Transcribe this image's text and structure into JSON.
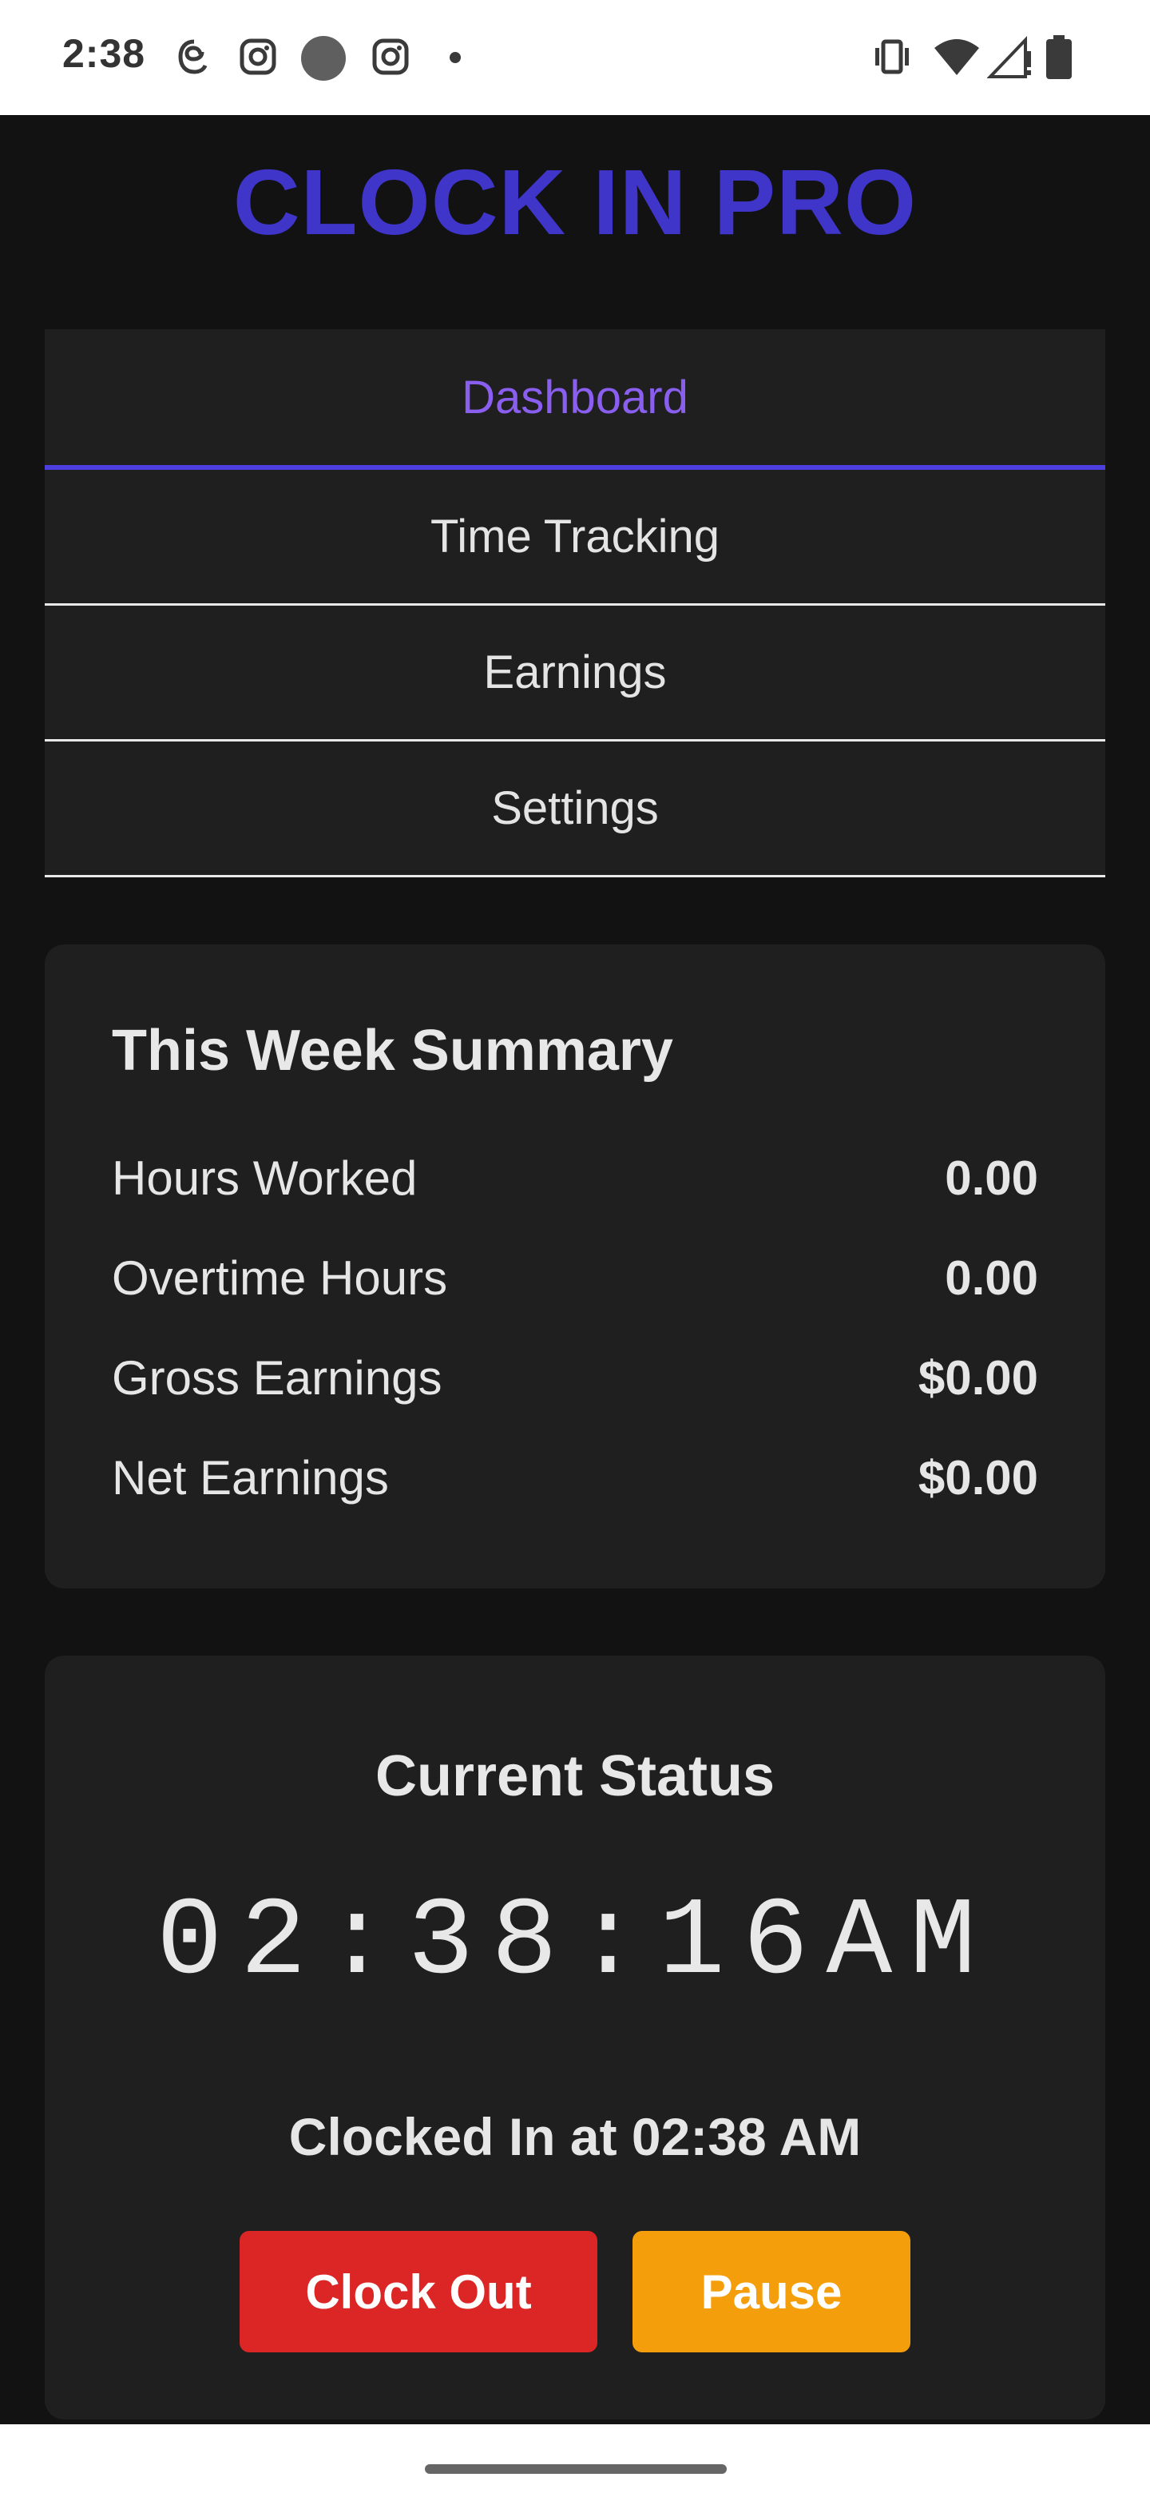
{
  "status_bar": {
    "time": "2:38",
    "left_icons": [
      "threads-icon",
      "instagram-icon",
      "circle-icon",
      "instagram-icon",
      "dot-icon"
    ],
    "right_icons": [
      "vibrate-icon",
      "wifi-icon",
      "signal-icon",
      "battery-icon"
    ]
  },
  "app": {
    "title": "CLOCK IN PRO",
    "accent_color": "#3f35c9"
  },
  "nav": {
    "items": [
      {
        "label": "Dashboard",
        "active": true
      },
      {
        "label": "Time Tracking",
        "active": false
      },
      {
        "label": "Earnings",
        "active": false
      },
      {
        "label": "Settings",
        "active": false
      }
    ]
  },
  "summary": {
    "title": "This Week Summary",
    "rows": [
      {
        "label": "Hours Worked",
        "value": "0.00"
      },
      {
        "label": "Overtime Hours",
        "value": "0.00"
      },
      {
        "label": "Gross Earnings",
        "value": "$0.00"
      },
      {
        "label": "Net Earnings",
        "value": "$0.00"
      }
    ]
  },
  "status": {
    "title": "Current Status",
    "clock": "02:38:16AM",
    "clocked_in_text": "Clocked In at 02:38 AM",
    "clock_out_label": "Clock Out",
    "pause_label": "Pause",
    "clock_out_color": "#dc2626",
    "pause_color": "#f59e0b"
  }
}
